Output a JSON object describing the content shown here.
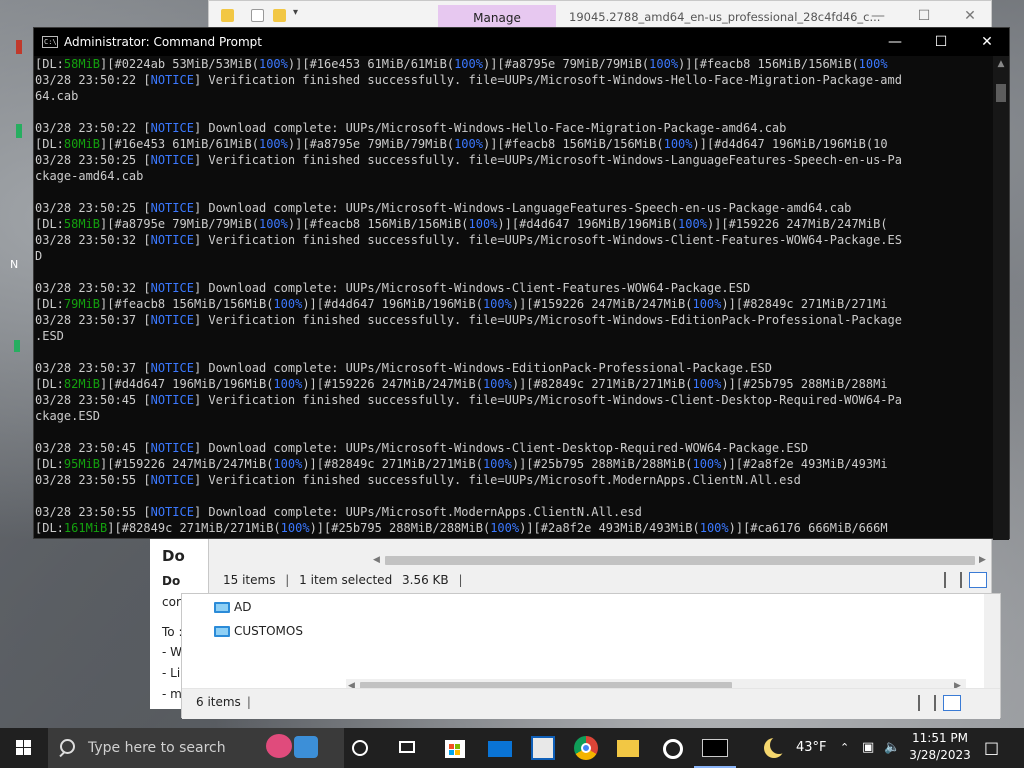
{
  "explorer": {
    "tab_manage": "Manage",
    "window_title": "19045.2788_amd64_en-us_professional_28c4fd46_c...",
    "status_items": "15 items",
    "status_selected": "1 item selected",
    "status_size": "3.56 KB",
    "tree": [
      "AD",
      "CUSTOMOS"
    ],
    "bottom_status": "6 items"
  },
  "doc_panel": {
    "title": "Do",
    "lines": [
      "Do",
      "cor",
      "To :",
      "- W",
      "- Li",
      "- m"
    ]
  },
  "cmd": {
    "title": "Administrator: Command Prompt",
    "lines": [
      [
        [
          "[DL:",
          "w"
        ],
        [
          "58MiB",
          "g"
        ],
        [
          "][#0224ab 53MiB/53MiB(",
          "w"
        ],
        [
          "100%",
          "b"
        ],
        [
          ")][#16e453 61MiB/61MiB(",
          "w"
        ],
        [
          "100%",
          "b"
        ],
        [
          ")][#a8795e 79MiB/79MiB(",
          "w"
        ],
        [
          "100%",
          "b"
        ],
        [
          ")][#feacb8 156MiB/156MiB(",
          "w"
        ],
        [
          "100%",
          "b"
        ]
      ],
      [
        [
          "03/28 23:50:22 [",
          "w"
        ],
        [
          "NOTICE",
          "b"
        ],
        [
          "] Verification finished successfully. file=UUPs/Microsoft-Windows-Hello-Face-Migration-Package-amd",
          "w"
        ]
      ],
      [
        [
          "64.cab",
          "w"
        ]
      ],
      [
        [
          "",
          "w"
        ]
      ],
      [
        [
          "03/28 23:50:22 [",
          "w"
        ],
        [
          "NOTICE",
          "b"
        ],
        [
          "] Download complete: UUPs/Microsoft-Windows-Hello-Face-Migration-Package-amd64.cab",
          "w"
        ]
      ],
      [
        [
          "[DL:",
          "w"
        ],
        [
          "80MiB",
          "g"
        ],
        [
          "][#16e453 61MiB/61MiB(",
          "w"
        ],
        [
          "100%",
          "b"
        ],
        [
          ")][#a8795e 79MiB/79MiB(",
          "w"
        ],
        [
          "100%",
          "b"
        ],
        [
          ")][#feacb8 156MiB/156MiB(",
          "w"
        ],
        [
          "100%",
          "b"
        ],
        [
          ")][#d4d647 196MiB/196MiB(10",
          "w"
        ]
      ],
      [
        [
          "03/28 23:50:25 [",
          "w"
        ],
        [
          "NOTICE",
          "b"
        ],
        [
          "] Verification finished successfully. file=UUPs/Microsoft-Windows-LanguageFeatures-Speech-en-us-Pa",
          "w"
        ]
      ],
      [
        [
          "ckage-amd64.cab",
          "w"
        ]
      ],
      [
        [
          "",
          "w"
        ]
      ],
      [
        [
          "03/28 23:50:25 [",
          "w"
        ],
        [
          "NOTICE",
          "b"
        ],
        [
          "] Download complete: UUPs/Microsoft-Windows-LanguageFeatures-Speech-en-us-Package-amd64.cab",
          "w"
        ]
      ],
      [
        [
          "[DL:",
          "w"
        ],
        [
          "58MiB",
          "g"
        ],
        [
          "][#a8795e 79MiB/79MiB(",
          "w"
        ],
        [
          "100%",
          "b"
        ],
        [
          ")][#feacb8 156MiB/156MiB(",
          "w"
        ],
        [
          "100%",
          "b"
        ],
        [
          ")][#d4d647 196MiB/196MiB(",
          "w"
        ],
        [
          "100%",
          "b"
        ],
        [
          ")][#159226 247MiB/247MiB(",
          "w"
        ]
      ],
      [
        [
          "03/28 23:50:32 [",
          "w"
        ],
        [
          "NOTICE",
          "b"
        ],
        [
          "] Verification finished successfully. file=UUPs/Microsoft-Windows-Client-Features-WOW64-Package.ES",
          "w"
        ]
      ],
      [
        [
          "D",
          "w"
        ]
      ],
      [
        [
          "",
          "w"
        ]
      ],
      [
        [
          "03/28 23:50:32 [",
          "w"
        ],
        [
          "NOTICE",
          "b"
        ],
        [
          "] Download complete: UUPs/Microsoft-Windows-Client-Features-WOW64-Package.ESD",
          "w"
        ]
      ],
      [
        [
          "[DL:",
          "w"
        ],
        [
          "79MiB",
          "g"
        ],
        [
          "][#feacb8 156MiB/156MiB(",
          "w"
        ],
        [
          "100%",
          "b"
        ],
        [
          ")][#d4d647 196MiB/196MiB(",
          "w"
        ],
        [
          "100%",
          "b"
        ],
        [
          ")][#159226 247MiB/247MiB(",
          "w"
        ],
        [
          "100%",
          "b"
        ],
        [
          ")][#82849c 271MiB/271Mi",
          "w"
        ]
      ],
      [
        [
          "03/28 23:50:37 [",
          "w"
        ],
        [
          "NOTICE",
          "b"
        ],
        [
          "] Verification finished successfully. file=UUPs/Microsoft-Windows-EditionPack-Professional-Package",
          "w"
        ]
      ],
      [
        [
          ".ESD",
          "w"
        ]
      ],
      [
        [
          "",
          "w"
        ]
      ],
      [
        [
          "03/28 23:50:37 [",
          "w"
        ],
        [
          "NOTICE",
          "b"
        ],
        [
          "] Download complete: UUPs/Microsoft-Windows-EditionPack-Professional-Package.ESD",
          "w"
        ]
      ],
      [
        [
          "[DL:",
          "w"
        ],
        [
          "82MiB",
          "g"
        ],
        [
          "][#d4d647 196MiB/196MiB(",
          "w"
        ],
        [
          "100%",
          "b"
        ],
        [
          ")][#159226 247MiB/247MiB(",
          "w"
        ],
        [
          "100%",
          "b"
        ],
        [
          ")][#82849c 271MiB/271MiB(",
          "w"
        ],
        [
          "100%",
          "b"
        ],
        [
          ")][#25b795 288MiB/288Mi",
          "w"
        ]
      ],
      [
        [
          "03/28 23:50:45 [",
          "w"
        ],
        [
          "NOTICE",
          "b"
        ],
        [
          "] Verification finished successfully. file=UUPs/Microsoft-Windows-Client-Desktop-Required-WOW64-Pa",
          "w"
        ]
      ],
      [
        [
          "ckage.ESD",
          "w"
        ]
      ],
      [
        [
          "",
          "w"
        ]
      ],
      [
        [
          "03/28 23:50:45 [",
          "w"
        ],
        [
          "NOTICE",
          "b"
        ],
        [
          "] Download complete: UUPs/Microsoft-Windows-Client-Desktop-Required-WOW64-Package.ESD",
          "w"
        ]
      ],
      [
        [
          "[DL:",
          "w"
        ],
        [
          "95MiB",
          "g"
        ],
        [
          "][#159226 247MiB/247MiB(",
          "w"
        ],
        [
          "100%",
          "b"
        ],
        [
          ")][#82849c 271MiB/271MiB(",
          "w"
        ],
        [
          "100%",
          "b"
        ],
        [
          ")][#25b795 288MiB/288MiB(",
          "w"
        ],
        [
          "100%",
          "b"
        ],
        [
          ")][#2a8f2e 493MiB/493Mi",
          "w"
        ]
      ],
      [
        [
          "03/28 23:50:55 [",
          "w"
        ],
        [
          "NOTICE",
          "b"
        ],
        [
          "] Verification finished successfully. file=UUPs/Microsoft.ModernApps.ClientN.All.esd",
          "w"
        ]
      ],
      [
        [
          "",
          "w"
        ]
      ],
      [
        [
          "03/28 23:50:55 [",
          "w"
        ],
        [
          "NOTICE",
          "b"
        ],
        [
          "] Download complete: UUPs/Microsoft.ModernApps.ClientN.All.esd",
          "w"
        ]
      ],
      [
        [
          "[DL:",
          "w"
        ],
        [
          "161MiB",
          "g"
        ],
        [
          "][#82849c 271MiB/271MiB(",
          "w"
        ],
        [
          "100%",
          "b"
        ],
        [
          ")][#25b795 288MiB/288MiB(",
          "w"
        ],
        [
          "100%",
          "b"
        ],
        [
          ")][#2a8f2e 493MiB/493MiB(",
          "w"
        ],
        [
          "100%",
          "b"
        ],
        [
          ")][#ca6176 666MiB/666M",
          "w"
        ]
      ]
    ]
  },
  "taskbar": {
    "search_placeholder": "Type here to search",
    "weather_temp": "43°F",
    "clock_time": "11:51 PM",
    "clock_date": "3/28/2023",
    "pinned_icons": [
      "cortana-icon",
      "task-view-icon",
      "store-icon",
      "mail-icon",
      "app-icon",
      "chrome-icon",
      "file-explorer-icon",
      "settings-icon",
      "command-prompt-icon"
    ]
  },
  "colors": {
    "console_green": "#13a10e",
    "console_blue": "#3b78ff",
    "console_text": "#cccccc",
    "manage_tab": "#e7c8f0"
  }
}
